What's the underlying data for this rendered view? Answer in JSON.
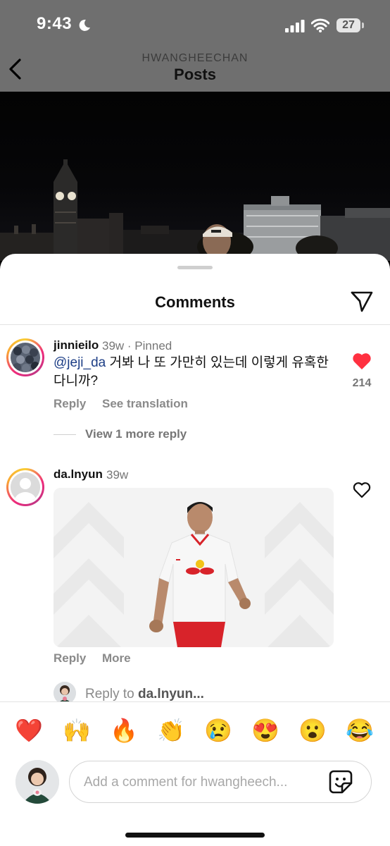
{
  "status_bar": {
    "time": "9:43",
    "battery": "27",
    "icons": [
      "moon-icon",
      "signal-icon",
      "wifi-icon",
      "battery-icon"
    ]
  },
  "header": {
    "subtitle": "HWANGHEECHAN",
    "title": "Posts",
    "back_icon": "chevron-left-icon"
  },
  "comments_sheet": {
    "title": "Comments",
    "share_icon": "paper-plane-icon",
    "comments": [
      {
        "username": "jinnieilo",
        "time": "39w",
        "pinned_label": "· Pinned",
        "mention": "@jeji_da",
        "text": " 거봐 나 또 가만히 있는데 이렇게 유혹한 다니까?",
        "reply_label": "Reply",
        "translate_label": "See translation",
        "like_count": "214",
        "liked": true,
        "view_replies_label": "View 1 more reply"
      },
      {
        "username": "da.lnyun",
        "time": "39w",
        "reply_label": "Reply",
        "more_label": "More",
        "liked": false
      }
    ],
    "reply_to": {
      "prefix": "Reply to ",
      "username": "da.lnyun..."
    }
  },
  "emoji_bar": [
    "❤️",
    "🙌",
    "🔥",
    "👏",
    "😢",
    "😍",
    "😮",
    "😂"
  ],
  "comment_input": {
    "placeholder": "Add a comment for hwangheech...",
    "sticker_icon": "sticker-icon"
  },
  "colors": {
    "like_red": "#ff3040",
    "mention_blue": "#1d3e86",
    "header_dim": "#6f6f6f"
  }
}
